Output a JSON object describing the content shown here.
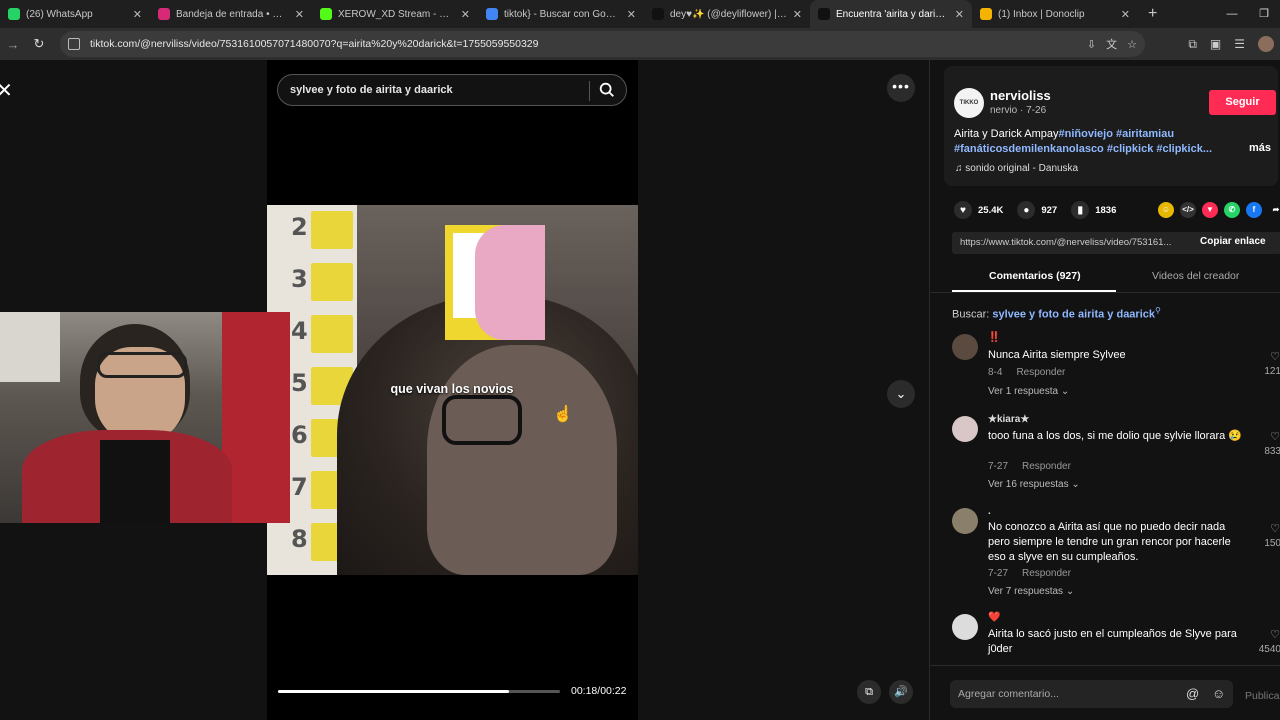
{
  "browser": {
    "tabs": [
      {
        "label": "(26) WhatsApp",
        "color": "#25d366",
        "active": false
      },
      {
        "label": "Bandeja de entrada • Direct",
        "color": "#d62976",
        "active": false
      },
      {
        "label": "XEROW_XD Stream - Watch Live",
        "color": "#53fc18",
        "active": false
      },
      {
        "label": "tiktok} - Buscar con Google",
        "color": "#4285f4",
        "active": false
      },
      {
        "label": "dey♥✨ (@deyliflower) | TikTok",
        "color": "#111111",
        "active": false
      },
      {
        "label": "Encuentra 'airita y darick' en TikTok",
        "color": "#111111",
        "active": true
      },
      {
        "label": "(1) Inbox | Donoclip",
        "color": "#f5b301",
        "active": false
      }
    ],
    "url": "tiktok.com/@nerviliss/video/7531610057071480070?q=airita%20y%20darick&t=1755059550329"
  },
  "viewer": {
    "search_text": "sylvee y foto de airita y daarick",
    "caption": "que vivan los novios",
    "time": "00:18/00:22",
    "progress": 0.82,
    "numbers": [
      "2",
      "3",
      "4",
      "5",
      "6",
      "7",
      "8"
    ]
  },
  "panel": {
    "author": {
      "name": "nervioliss",
      "sub": "nervio · 7-26",
      "follow_label": "Seguir"
    },
    "desc_plain": "Airita y Darick Ampay",
    "desc_tags_1": "#niñoviejo #airitamiau",
    "desc_tags_2": "#fanáticosdemilenkanolasco #clipkick #clipkick...",
    "more_label": "más",
    "sound": "sonido original - Danuska",
    "likes": "25.4K",
    "comments_count": "927",
    "saves": "1836",
    "link": "https://www.tiktok.com/@nerveliss/video/753161...",
    "copy_label": "Copiar enlace",
    "tab_comments": "Comentarios (927)",
    "tab_creator": "Videos del creador",
    "search_hint_prefix": "Buscar:",
    "search_hint_term": "sylvee y foto de airita y daarick",
    "comments": [
      {
        "user": "‼️",
        "text": "Nunca Airita siempre Sylvee",
        "date": "8-4",
        "reply": "Responder",
        "more": "Ver 1 respuesta ⌄",
        "likes": "121",
        "avatar_color": "#5a4a40"
      },
      {
        "user": "★kiara★",
        "text": "tooo funa a los dos, si me dolio que sylvie llorara 😢",
        "date": "7-27",
        "reply": "Responder",
        "more": "Ver 16 respuestas ⌄",
        "likes": "833",
        "avatar_color": "#d9c6c6"
      },
      {
        "user": ".",
        "text": "No conozco a Airita así que no puedo decir nada pero siempre le tendre un gran rencor por hacerle eso a slyve en su cumpleaños.",
        "date": "7-27",
        "reply": "Responder",
        "more": "Ver 7 respuestas ⌄",
        "likes": "150",
        "avatar_color": "#8a7f6a"
      },
      {
        "user": "❤️",
        "text": "Airita lo sacó justo en el cumpleaños de Slyve para j0der",
        "date": "",
        "reply": "",
        "more": "",
        "likes": "4540",
        "avatar_color": "#dcdcdc"
      }
    ],
    "add_comment_placeholder": "Agregar comentario...",
    "publish_label": "Publicar"
  }
}
